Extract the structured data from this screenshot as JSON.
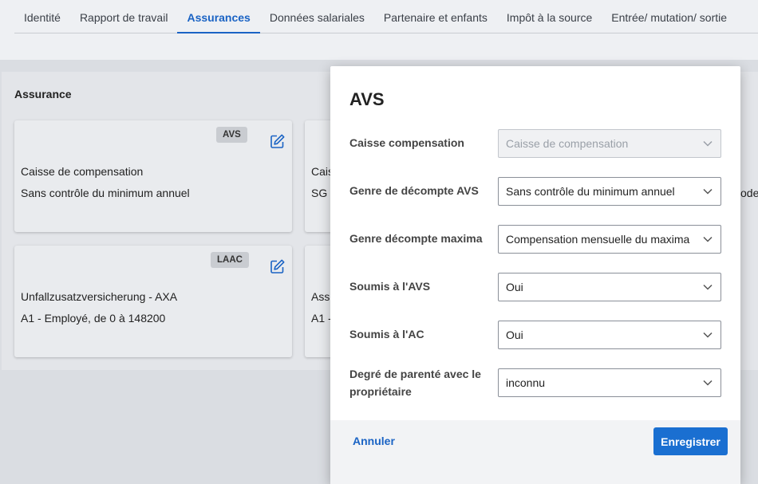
{
  "tabs": [
    {
      "label": "Identité"
    },
    {
      "label": "Rapport de travail"
    },
    {
      "label": "Assurances"
    },
    {
      "label": "Données salariales"
    },
    {
      "label": "Partenaire et enfants"
    },
    {
      "label": "Impôt à la source"
    },
    {
      "label": "Entrée/ mutation/ sortie"
    }
  ],
  "active_tab": "Assurances",
  "section": {
    "title": "Assurance"
  },
  "cards": [
    {
      "badge": "AVS",
      "line1": "Caisse de compensation",
      "line2": "Sans contrôle du minimum annuel"
    },
    {
      "badge": "LAAC",
      "line1": "Unfallzusatzversicherung - AXA",
      "line2": "A1 - Employé, de 0 à 148200"
    },
    {
      "line1": "Cais",
      "line2": "SG"
    },
    {
      "line1": "Ass",
      "line2": "A1 -"
    }
  ],
  "right_fragment": "ode",
  "modal": {
    "title": "AVS",
    "fields": [
      {
        "label": "Caisse compensation",
        "value": "Caisse de compensation"
      },
      {
        "label": "Genre de décompte AVS",
        "value": "Sans contrôle du minimum annuel"
      },
      {
        "label": "Genre décompte maxima",
        "value": "Compensation mensuelle du maxima"
      },
      {
        "label": "Soumis à l'AVS",
        "value": "Oui"
      },
      {
        "label": "Soumis à l'AC",
        "value": "Oui"
      },
      {
        "label": "Degré de parenté avec le propriétaire",
        "value": "inconnu"
      }
    ],
    "cancel_label": "Annuler",
    "save_label": "Enregistrer"
  },
  "colors": {
    "accent": "#1a63c4",
    "primary_button": "#1a6fd1"
  }
}
